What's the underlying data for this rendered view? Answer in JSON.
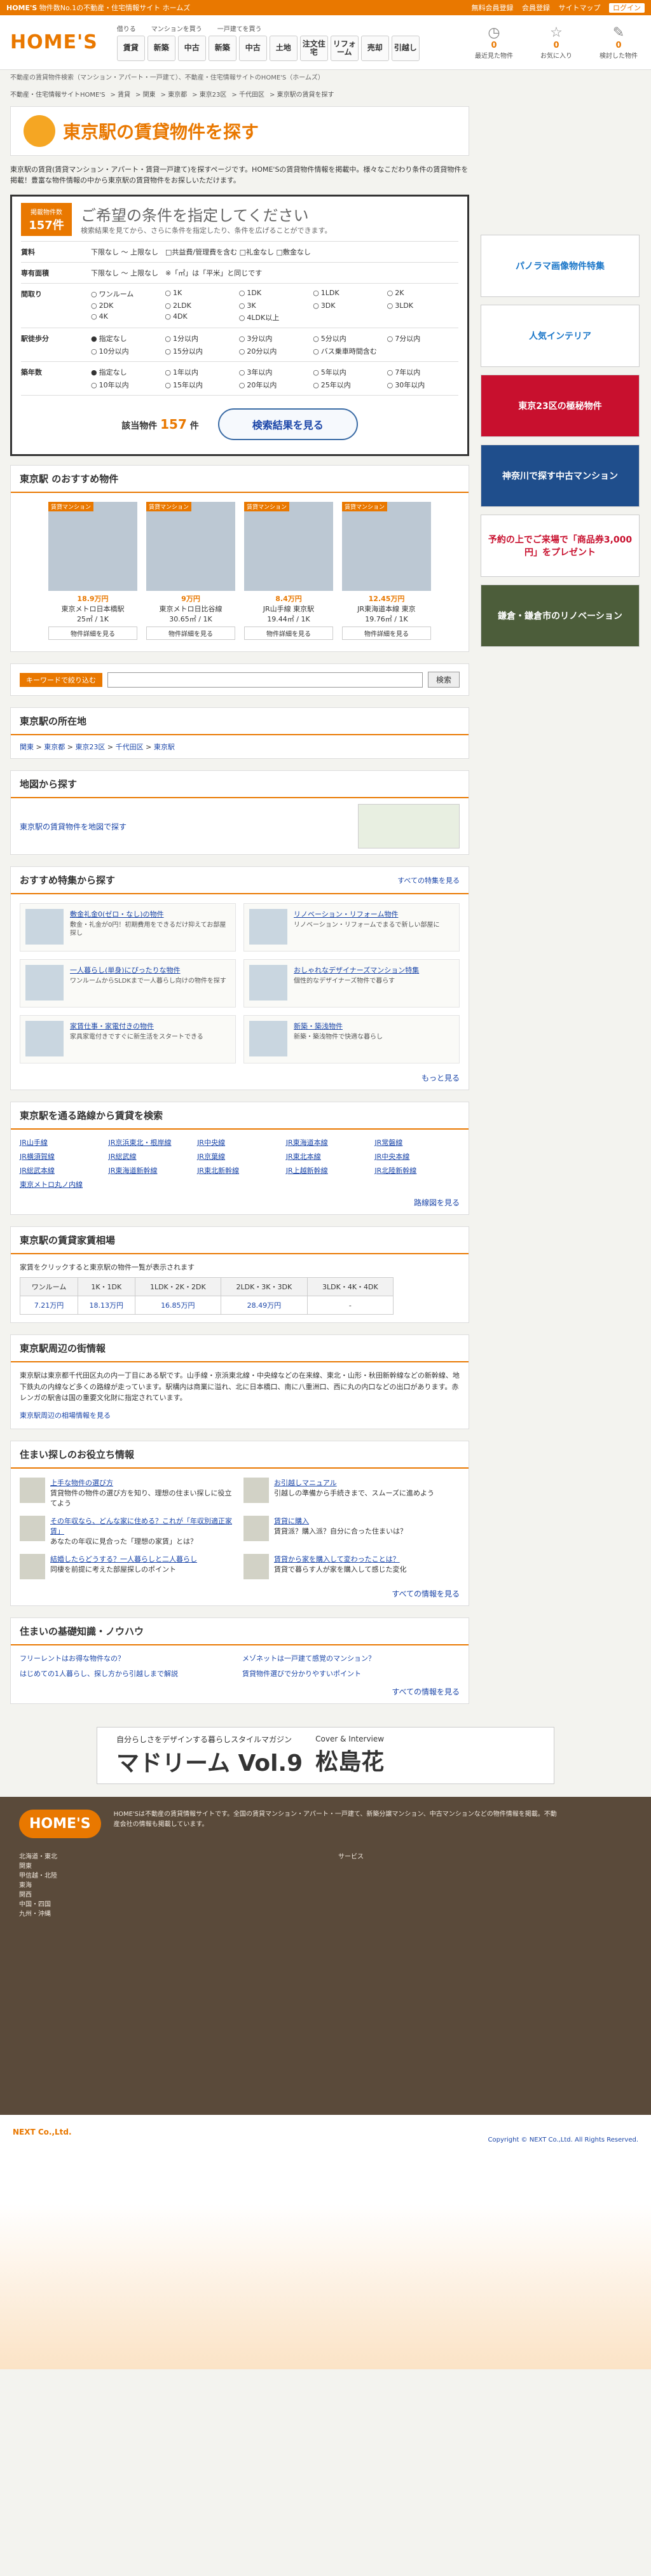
{
  "topbar": {
    "brand": "HOME'S",
    "tagline": "物件数No.1の不動産・住宅情報サイト ホームズ",
    "links": [
      "無料会員登録",
      "会員登録",
      "サイトマップ"
    ],
    "login": "ログイン"
  },
  "header": {
    "logo": "HOME'S",
    "cat_heads": [
      "借りる",
      "マンションを買う",
      "一戸建てを買う"
    ],
    "categories": [
      "賃貸",
      "新築",
      "中古",
      "新築",
      "中古",
      "土地",
      "注文住宅",
      "リフォーム",
      "売却",
      "引越し"
    ],
    "icons": [
      {
        "label": "最近見た物件",
        "count": "0"
      },
      {
        "label": "お気に入り",
        "count": "0"
      },
      {
        "label": "検討した物件",
        "count": "0"
      }
    ]
  },
  "top_breadcrumb": "不動産の賃貸物件検索（マンション・アパート・一戸建て）、不動産・住宅情報サイトのHOME'S（ホームズ）",
  "breadcrumb": [
    "不動産・住宅情報サイトHOME'S",
    "賃貸",
    "関東",
    "東京都",
    "東京23区",
    "千代田区",
    "東京駅の賃貸を探す"
  ],
  "title": "東京駅の賃貸物件を探す",
  "intro": "東京駅の賃貸(賃貸マンション・アパート・賃貸一戸建て)を探すページです。HOME'Sの賃貸物件情報を掲載中。様々なこだわり条件の賃貸物件を掲載！豊富な物件情報の中から東京駅の賃貸物件をお探しいただけます。",
  "search": {
    "count_label": "掲載物件数",
    "count": "157件",
    "title": "ご希望の条件を指定してください",
    "subtitle": "検索結果を見てから、さらに条件を指定したり、条件を広げることができます。",
    "rows": [
      {
        "label": "賃料",
        "value": "下限なし 〜 上限なし　□共益費/管理費を含む □礼金なし □敷金なし"
      },
      {
        "label": "専有面積",
        "value": "下限なし 〜 上限なし　※「㎡」は「平米」と同じです"
      },
      {
        "label": "間取り",
        "opts": [
          "ワンルーム",
          "1K",
          "1DK",
          "1LDK",
          "2K",
          "2DK",
          "2LDK",
          "3K",
          "3DK",
          "3LDK",
          "4K",
          "4DK",
          "4LDK以上"
        ]
      },
      {
        "label": "駅徒歩分",
        "opts": [
          "指定なし",
          "1分以内",
          "3分以内",
          "5分以内",
          "7分以内",
          "10分以内",
          "15分以内",
          "20分以内",
          "バス乗車時間含む"
        ]
      },
      {
        "label": "築年数",
        "opts": [
          "指定なし",
          "1年以内",
          "3年以内",
          "5年以内",
          "7年以内",
          "10年以内",
          "15年以内",
          "20年以内",
          "25年以内",
          "30年以内"
        ]
      }
    ],
    "result_label": "該当物件",
    "result_count": "157",
    "result_unit": "件",
    "button": "検索結果を見る"
  },
  "recommend": {
    "title": "東京駅 のおすすめ物件",
    "items": [
      {
        "tag": "賃貸マンション",
        "price": "18.9万円",
        "name": "東京メトロ日本橋駅",
        "spec": "25㎡ / 1K",
        "link": "物件詳細を見る"
      },
      {
        "tag": "賃貸マンション",
        "price": "9万円",
        "name": "東京メトロ日比谷線",
        "spec": "30.65㎡ / 1K",
        "link": "物件詳細を見る"
      },
      {
        "tag": "賃貸マンション",
        "price": "8.4万円",
        "name": "JR山手線 東京駅",
        "spec": "19.44㎡ / 1K",
        "link": "物件詳細を見る"
      },
      {
        "tag": "賃貸マンション",
        "price": "12.45万円",
        "name": "JR東海道本線 東京",
        "spec": "19.76㎡ / 1K",
        "link": "物件詳細を見る"
      }
    ]
  },
  "keyword": {
    "label": "キーワードで絞り込む",
    "button": "検索"
  },
  "location": {
    "title": "東京駅の所在地",
    "path": [
      "関東",
      "東京都",
      "東京23区",
      "千代田区",
      "東京駅"
    ]
  },
  "map": {
    "title": "地図から探す",
    "link": "東京駅の賃貸物件を地図で探す"
  },
  "features": {
    "title": "おすすめ特集から探す",
    "more": "すべての特集を見る",
    "cards": [
      {
        "t": "敷金礼金0(ゼロ・なし)の物件",
        "d": "敷金・礼金が0円！初期費用をできるだけ抑えてお部屋探し"
      },
      {
        "t": "リノベーション・リフォーム物件",
        "d": "リノベーション・リフォームでまるで新しい部屋に"
      },
      {
        "t": "一人暮らし(単身)にぴったりな物件",
        "d": "ワンルームからSLDKまで一人暮らし向けの物件を探す"
      },
      {
        "t": "おしゃれなデザイナーズマンション特集",
        "d": "個性的なデザイナーズ物件で暮らす"
      },
      {
        "t": "家賃仕事・家電付きの物件",
        "d": "家具家電付きですぐに新生活をスタートできる"
      },
      {
        "t": "新築・築浅物件",
        "d": "新築・築浅物件で快適な暮らし"
      }
    ],
    "next": "もっと見る"
  },
  "lines": {
    "title": "東京駅を通る路線から賃貸を検索",
    "items": [
      "JR山手線",
      "JR京浜東北・根岸線",
      "JR中央線",
      "JR東海道本線",
      "JR常磐線",
      "JR横須賀線",
      "JR総武線",
      "JR京葉線",
      "JR東北本線",
      "JR中央本線",
      "JR総武本線",
      "JR東海道新幹線",
      "JR東北新幹線",
      "JR上越新幹線",
      "JR北陸新幹線",
      "東京メトロ丸ノ内線"
    ],
    "more": "路線図を見る"
  },
  "rent": {
    "title": "東京駅の賃貸家賃相場",
    "note": "家賃をクリックすると東京駅の物件一覧が表示されます",
    "heads": [
      "ワンルーム",
      "1K・1DK",
      "1LDK・2K・2DK",
      "2LDK・3K・3DK",
      "3LDK・4K・4DK"
    ],
    "vals": [
      "7.21万円",
      "18.13万円",
      "16.85万円",
      "28.49万円",
      "-"
    ]
  },
  "area": {
    "title": "東京駅周辺の街情報",
    "body": "東京駅は東京都千代田区丸の内一丁目にある駅です。山手線・京浜東北線・中央線などの在来線、東北・山形・秋田新幹線などの新幹線、地下鉄丸の内線など多くの路線が走っています。駅構内は商業に溢れ、北に日本橋口、南に八重洲口、西に丸の内口などの出口があります。赤レンガの駅舎は国の重要文化財に指定されています。",
    "link": "東京駅周辺の相場情報を見る"
  },
  "tips": {
    "title": "住まい探しのお役立ち情報",
    "items": [
      {
        "t": "上手な物件の選び方",
        "d": "賃貸物件の物件の選び方を知り、理想の住まい探しに役立てよう"
      },
      {
        "t": "お引越しマニュアル",
        "d": "引越しの準備から手続きまで、スムーズに進めよう"
      },
      {
        "t": "その年収なら、どんな家に住める？これが「年収別適正家賃」",
        "d": "あなたの年収に見合った「理想の家賃」とは？"
      },
      {
        "t": "賃貸に購入",
        "d": "賃貸派？購入派？自分に合った住まいは？"
      },
      {
        "t": "結婚したらどうする？一人暮らしと二人暮らし",
        "d": "同棲を前提に考えた部屋探しのポイント"
      },
      {
        "t": "賃貸から家を購入して変わったことは？",
        "d": "賃貸で暮らす人が家を購入して感じた変化"
      }
    ],
    "more": "すべての情報を見る"
  },
  "basics": {
    "title": "住まいの基礎知識・ノウハウ",
    "items": [
      "フリーレントはお得な物件なの？",
      "メゾネットは一戸建て感覚のマンション？",
      "はじめての1人暮らし、探し方から引越しまで解説",
      "賃貸物件選びで分かりやすいポイント"
    ],
    "more": "すべての情報を見る"
  },
  "banner": {
    "head": "自分らしさをデザインする暮らしスタイルマガジン",
    "name": "マドリーム Vol.9",
    "cover": "Cover & Interview",
    "person": "松島花"
  },
  "footer": {
    "logo": "HOME'S",
    "text": "HOME'Sは不動産の賃貸情報サイトです。全国の賃貸マンション・アパート・一戸建て、新築分譲マンション、中古マンションなどの物件情報を掲載。不動産会社の情報も掲載しています。",
    "regions": [
      "北海道・東北",
      "関東",
      "甲信越・北陸",
      "東海",
      "関西",
      "中国・四国",
      "九州・沖縄"
    ],
    "services": "サービス",
    "company": "NEXT Co.,Ltd.",
    "copyright": "Copyright © NEXT Co.,Ltd. All Rights Reserved."
  }
}
